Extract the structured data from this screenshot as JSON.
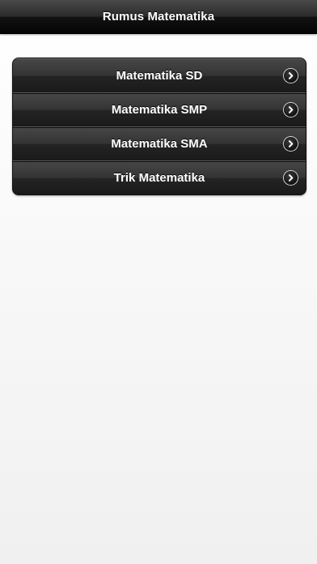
{
  "header": {
    "title": "Rumus Matematika"
  },
  "menu": {
    "items": [
      {
        "label": "Matematika SD",
        "icon": "chevron-right-icon"
      },
      {
        "label": "Matematika SMP",
        "icon": "chevron-right-icon"
      },
      {
        "label": "Matematika SMA",
        "icon": "chevron-right-icon"
      },
      {
        "label": "Trik Matematika",
        "icon": "chevron-right-icon"
      }
    ]
  },
  "colors": {
    "nav_bar": "#1a1a1a",
    "menu_item": "#2e2e2e",
    "text": "#ffffff",
    "background": "#f5f5f5"
  }
}
